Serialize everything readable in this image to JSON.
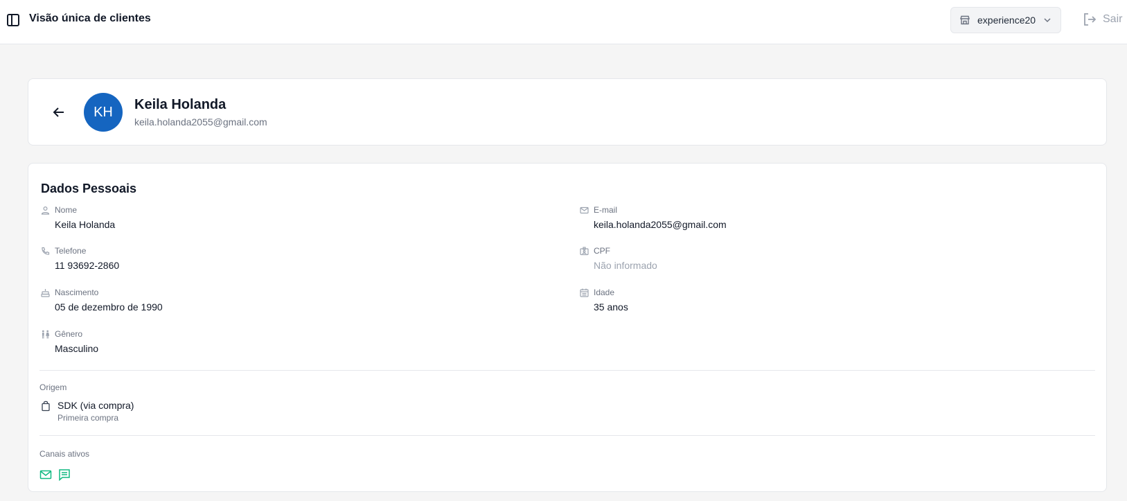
{
  "topbar": {
    "title": "Visão única de clientes",
    "store_select": {
      "value": "experience20"
    },
    "logout_label": "Sair"
  },
  "profile": {
    "initials": "KH",
    "name": "Keila Holanda",
    "email": "keila.holanda2055@gmail.com",
    "avatar_color": "#1565c0"
  },
  "personal": {
    "title": "Dados Pessoais",
    "fields": {
      "nome": {
        "label": "Nome",
        "value": "Keila Holanda"
      },
      "email": {
        "label": "E-mail",
        "value": "keila.holanda2055@gmail.com"
      },
      "telefone": {
        "label": "Telefone",
        "value": "11 93692-2860"
      },
      "cpf": {
        "label": "CPF",
        "value": "Não informado"
      },
      "nascimento": {
        "label": "Nascimento",
        "value": "05 de dezembro de 1990"
      },
      "idade": {
        "label": "Idade",
        "value": "35 anos"
      },
      "genero": {
        "label": "Gênero",
        "value": "Masculino"
      }
    }
  },
  "origin": {
    "label": "Origem",
    "value": "SDK (via compra)",
    "sub": "Primeira compra"
  },
  "channels": {
    "label": "Canais ativos",
    "items": [
      "mail-icon",
      "chat-icon"
    ],
    "color": "#10b981"
  }
}
